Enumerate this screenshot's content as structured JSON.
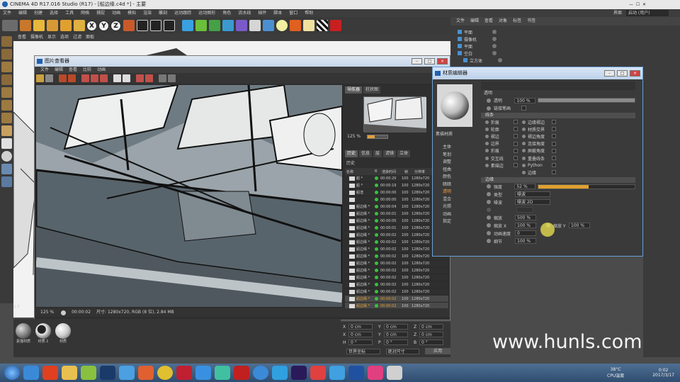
{
  "app": {
    "title": "CINEMA 4D R17.016 Studio (R17) - [船边缘.c4d *] - 主要",
    "interface_label": "界面",
    "interface_value": "启动 (用户)",
    "menu": [
      "文件",
      "编辑",
      "创建",
      "选择",
      "工具",
      "网格",
      "捕捉",
      "动画",
      "模拟",
      "渲染",
      "雕刻",
      "运动跟踪",
      "运动图形",
      "角色",
      "流水线",
      "插件",
      "脚本",
      "窗口",
      "帮助"
    ],
    "viewport_menu": [
      "查看",
      "摄像机",
      "显示",
      "选项",
      "过滤",
      "面板"
    ],
    "toolbar_xyz": [
      "X",
      "Y",
      "Z"
    ]
  },
  "object_manager": {
    "menu": [
      "文件",
      "编辑",
      "查看",
      "对象",
      "标签",
      "书签"
    ],
    "objects": [
      "平面",
      "摄像机",
      "平面",
      "空白",
      "立方体"
    ]
  },
  "picture_viewer": {
    "title": "图片查看器",
    "menu": [
      "文件",
      "编辑",
      "查看",
      "比较",
      "动画"
    ],
    "nav_tabs": [
      "导航器",
      "柱状图"
    ],
    "zoom": "125 %",
    "history_tabs": [
      "历史",
      "信息",
      "层",
      "滤镜",
      "立体"
    ],
    "history_label": "历史",
    "history_headers": [
      "名称",
      "R",
      "渲染时间",
      "帧",
      "分辨率"
    ],
    "history": [
      {
        "name": "船 *",
        "time": "00:00:20",
        "frame": "100",
        "res": "1280x720"
      },
      {
        "name": "船 *",
        "time": "00:00:19",
        "frame": "100",
        "res": "1280x720"
      },
      {
        "name": "船渲",
        "time": "00:00:00",
        "frame": "100",
        "res": "1280x720"
      },
      {
        "name": "",
        "time": "00:00:00",
        "frame": "100",
        "res": "1280x720"
      },
      {
        "name": "船边缘 *",
        "time": "00:00:04",
        "frame": "100",
        "res": "1280x720"
      },
      {
        "name": "船边缘 *",
        "time": "00:00:01",
        "frame": "100",
        "res": "1280x720"
      },
      {
        "name": "船边缘 *",
        "time": "00:00:05",
        "frame": "100",
        "res": "1280x720"
      },
      {
        "name": "船边缘 *",
        "time": "00:00:01",
        "frame": "100",
        "res": "1280x720"
      },
      {
        "name": "船边缘 *",
        "time": "00:00:02",
        "frame": "100",
        "res": "1280x720"
      },
      {
        "name": "船边缘 *",
        "time": "00:00:02",
        "frame": "100",
        "res": "1280x720"
      },
      {
        "name": "船边缘 *",
        "time": "00:00:02",
        "frame": "100",
        "res": "1280x720"
      },
      {
        "name": "船边缘 *",
        "time": "00:00:02",
        "frame": "100",
        "res": "1280x720"
      },
      {
        "name": "船边缘 *",
        "time": "00:00:02",
        "frame": "100",
        "res": "1280x720"
      },
      {
        "name": "船边缘 *",
        "time": "00:00:02",
        "frame": "100",
        "res": "1280x720"
      },
      {
        "name": "船边缘 *",
        "time": "00:00:02",
        "frame": "100",
        "res": "1280x720"
      },
      {
        "name": "船边缘 *",
        "time": "00:00:02",
        "frame": "100",
        "res": "1280x720"
      },
      {
        "name": "船边缘 *",
        "time": "00:00:02",
        "frame": "100",
        "res": "1280x720"
      },
      {
        "name": "船边缘 *",
        "time": "00:00:02",
        "frame": "100",
        "res": "1280x720"
      },
      {
        "name": "船边缘 *",
        "time": "00:00:02",
        "frame": "100",
        "res": "1280x720"
      }
    ],
    "status_zoom": "125 %",
    "status_time": "00:00:02",
    "status_info": "尺寸: 1280x720, RGB (8 位), 2.84 MB"
  },
  "material_editor": {
    "title": "材质编辑器",
    "material_name": "素描材质",
    "channels": [
      "主体",
      "笔划",
      "调整",
      "扭曲",
      "颜色",
      "暗暗",
      "透明",
      "混合",
      "光照",
      "动画",
      "指定"
    ],
    "active_channel": "透明",
    "transparency_section": "透明",
    "transparency_label": "透明",
    "transparency_value": "100 %",
    "transparency_fill": 1.0,
    "other_label": "链接笔画",
    "lines_section": "线条",
    "lines_left": [
      "折痕",
      "轮廓",
      "褶边",
      "边界",
      "折痕",
      "交互线",
      "素描边"
    ],
    "lines_right": [
      "边缘褶边",
      "材质交界",
      "褶边角度",
      "连接角度",
      "屏蔽角度",
      "重叠线条",
      "Python",
      "边缘"
    ],
    "edge_section": "边缘",
    "strength_label": "强度",
    "strength_value": "52 %",
    "strength_fill": 0.52,
    "type_label": "类型",
    "type_value": "噪波",
    "noise_label": "噪波",
    "noise_value": "噪波 2D",
    "scale_label": "缩放",
    "scale_value": "500 %",
    "scale_x_label": "缩放 X",
    "scale_x_value": "100 %",
    "scale_y_label": "缩放 Y",
    "scale_y_value": "100 %",
    "anim_speed_label": "动画速度",
    "anim_speed_value": "0",
    "detail_label": "细节",
    "detail_value": "100 %"
  },
  "materials": [
    "素描材质",
    "材质.1",
    "材质"
  ],
  "bottom": {
    "frame": "0 F",
    "apply_label": "应用",
    "coord_labels": [
      "X",
      "Y",
      "Z",
      "X",
      "Y",
      "Z",
      "H",
      "P",
      "B"
    ],
    "coord_values": [
      "0 cm",
      "0 cm",
      "0 cm",
      "0 cm",
      "0 cm",
      "0 cm",
      "0 °",
      "0 °",
      "0 °"
    ],
    "object_mode": "世界坐标",
    "size_mode": "绝对尺寸"
  },
  "watermark": "www.hunls.com",
  "taskbar": {
    "temperature": "38°C",
    "cpu_label": "CPU温度",
    "time": "0:02",
    "date": "2017/3/17"
  }
}
